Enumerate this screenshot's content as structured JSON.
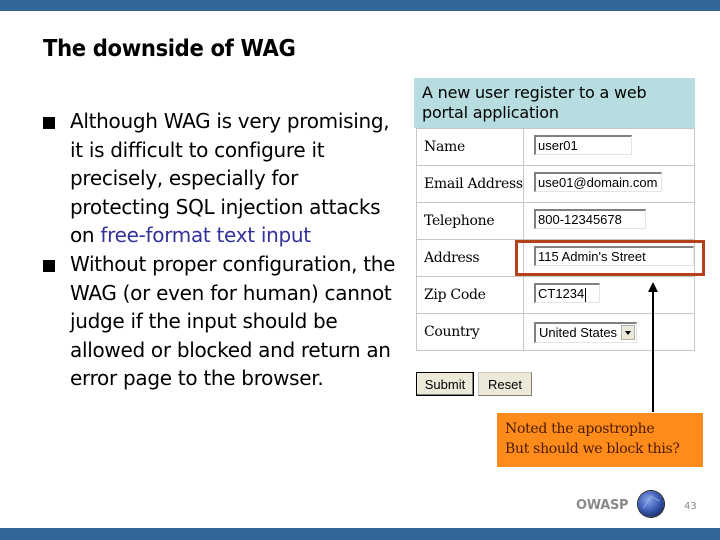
{
  "colors": {
    "brand_bar": "#336699",
    "highlight_text": "#333399",
    "form_header_bg": "#b8dde0",
    "highlight_box": "#b5401c",
    "callout_bg": "#ff8c1a",
    "callout_text": "#4a1a00"
  },
  "slide": {
    "title": "The downside of WAG",
    "bullets": [
      {
        "text_before": "Although WAG is very promising, it is difficult to configure it precisely, especially for protecting SQL injection attacks on ",
        "text_highlight": "free-format text input",
        "text_after": ""
      },
      {
        "text_before": "Without proper configuration, the WAG (or even for human) cannot judge if the input should be allowed or blocked and return an error page to the browser.",
        "text_highlight": "",
        "text_after": ""
      }
    ]
  },
  "form": {
    "header": "A new user register to a web portal application",
    "fields": [
      {
        "label": "Name",
        "value": "user01"
      },
      {
        "label": "Email Address",
        "value": "use01@domain.com"
      },
      {
        "label": "Telephone",
        "value": "800-12345678"
      },
      {
        "label": "Address",
        "value": "115 Admin's Street"
      },
      {
        "label": "Zip Code",
        "value": "CT1234"
      },
      {
        "label": "Country",
        "value": "United States"
      }
    ],
    "submit_label": "Submit",
    "reset_label": "Reset"
  },
  "callout": {
    "line1": "Noted the apostrophe",
    "line2": "But should we block this?"
  },
  "footer": {
    "brand": "OWASP",
    "page_number": "43"
  }
}
